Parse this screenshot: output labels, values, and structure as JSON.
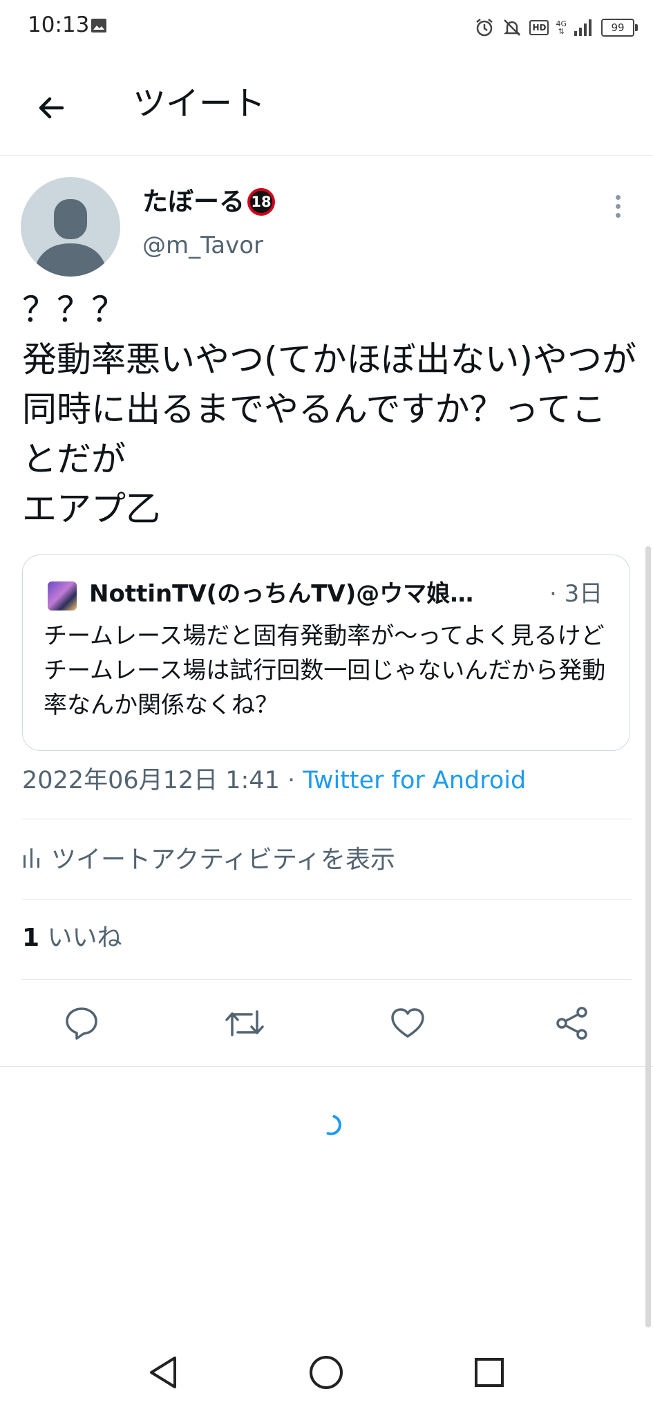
{
  "status_bar": {
    "time": "10:13",
    "network_label": "4G",
    "battery": "99"
  },
  "header": {
    "title": "ツイート"
  },
  "tweet": {
    "author_name": "たぼーる",
    "author_badge": "18",
    "handle": "@m_Tavor",
    "text": "？？？\n発動率悪いやつ(てかほぼ出ない)やつが同時に出るまでやるんですか？ってことだが\nエアプ乙",
    "quote": {
      "author": "NottinTV(のっちんTV)@ウマ娘攻略",
      "time": "· 3日",
      "text": "チームレース場だと固有発動率が〜ってよく見るけどチームレース場は試行回数一回じゃないんだから発動率なんか関係なくね？"
    },
    "timestamp": "2022年06月12日 1:41 · ",
    "source": "Twitter for Android",
    "activity_label": "ツイートアクティビティを表示",
    "like_count": "1",
    "like_label": " いいね"
  },
  "colors": {
    "accent": "#1d9bf0",
    "secondary_text": "#536471",
    "divider": "#e3e6e8"
  },
  "icons": [
    "back-arrow-icon",
    "more-icon",
    "reply-icon",
    "retweet-icon",
    "like-icon",
    "share-icon",
    "activity-icon",
    "loading-spinner-icon"
  ]
}
